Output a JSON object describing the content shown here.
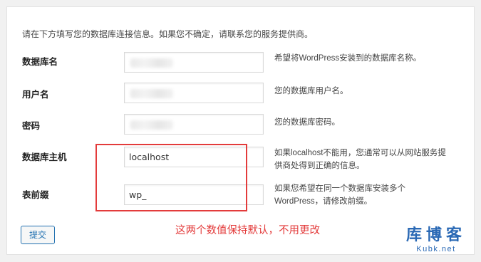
{
  "intro": "请在下方填写您的数据库连接信息。如果您不确定，请联系您的服务提供商。",
  "rows": [
    {
      "label": "数据库名",
      "value": "",
      "help": "希望将WordPress安装到的数据库名称。"
    },
    {
      "label": "用户名",
      "value": "",
      "help": "您的数据库用户名。"
    },
    {
      "label": "密码",
      "value": "",
      "help": "您的数据库密码。"
    },
    {
      "label": "数据库主机",
      "value": "localhost",
      "help": "如果localhost不能用，您通常可以从网站服务提供商处得到正确的信息。"
    },
    {
      "label": "表前缀",
      "value": "wp_",
      "help": "如果您希望在同一个数据库安装多个WordPress，请修改前缀。"
    }
  ],
  "submit_label": "提交",
  "annotation": "这两个数值保持默认，不用更改",
  "watermark": {
    "name": "库博客",
    "domain": "Kubk.net"
  },
  "colors": {
    "accent": "#2271b1",
    "annotation_red": "#e33b3b",
    "watermark_blue": "#2a69b5"
  }
}
